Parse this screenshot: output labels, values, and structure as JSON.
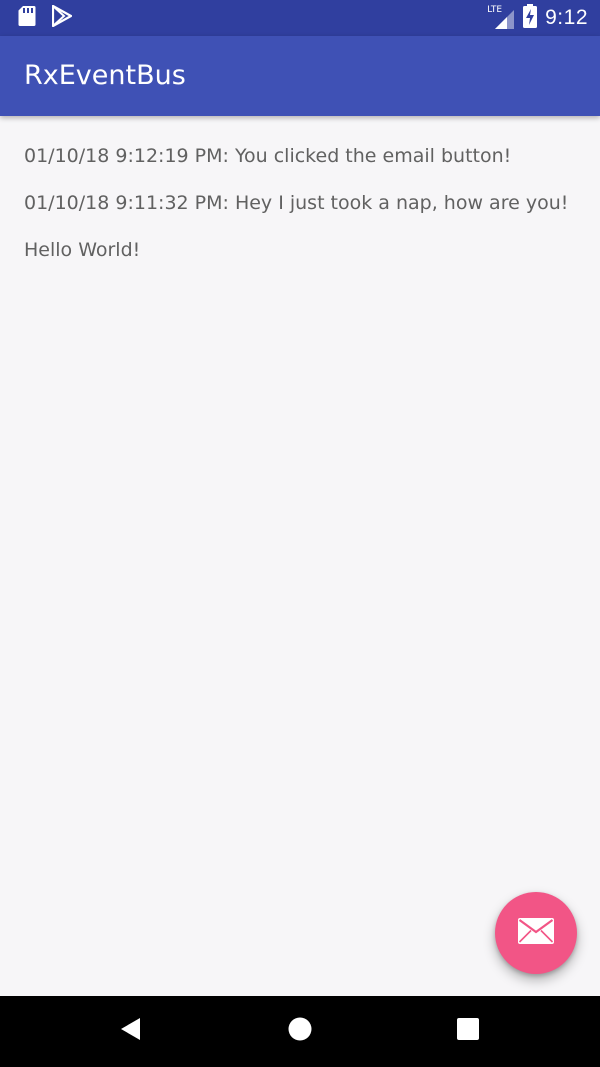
{
  "status_bar": {
    "network_label": "LTE",
    "time": "9:12",
    "icons": [
      "sd-card-icon",
      "play-store-icon",
      "signal-icon",
      "battery-charging-icon"
    ]
  },
  "app_bar": {
    "title": "RxEventBus"
  },
  "messages": [
    "01/10/18 9:12:19 PM: You clicked the email button!",
    "01/10/18 9:11:32 PM: Hey I just took a nap, how are you!",
    "Hello World!"
  ],
  "fab": {
    "icon": "email-icon"
  },
  "nav_bar": {
    "buttons": [
      "back-icon",
      "home-icon",
      "recents-icon"
    ]
  },
  "colors": {
    "status_bar": "#303f9f",
    "primary": "#3f51b5",
    "accent": "#f25586",
    "background": "#f7f6f8",
    "text": "#616161"
  }
}
